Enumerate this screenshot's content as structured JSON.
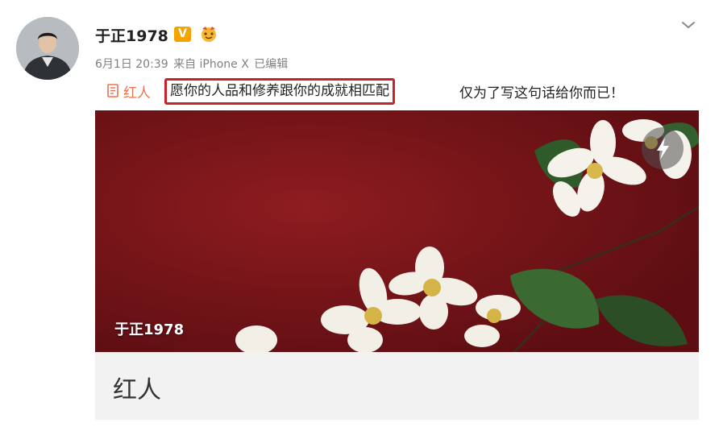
{
  "post": {
    "author": {
      "name": "于正1978",
      "badge": "V"
    },
    "meta": {
      "date": "6月1日 20:39",
      "source": "来自 iPhone X",
      "edited": "已编辑"
    },
    "content": {
      "topic": "红人",
      "highlighted": "愿你的人品和修养跟你的成就相匹配",
      "trailing": "仅为了写这句话给你而已！"
    },
    "card": {
      "image_caption": "于正1978",
      "title": "红人"
    }
  },
  "icons": {
    "avatar": "avatar",
    "verified": "verified-v-icon",
    "fan": "fan-badge-icon",
    "more": "chevron-down-icon",
    "topic": "book-icon",
    "flash": "lightning-icon"
  },
  "colors": {
    "topic_link": "#eb7350",
    "highlight_border": "#c62428",
    "image_background": "#7a1418",
    "verified_badge": "#f4a300"
  }
}
